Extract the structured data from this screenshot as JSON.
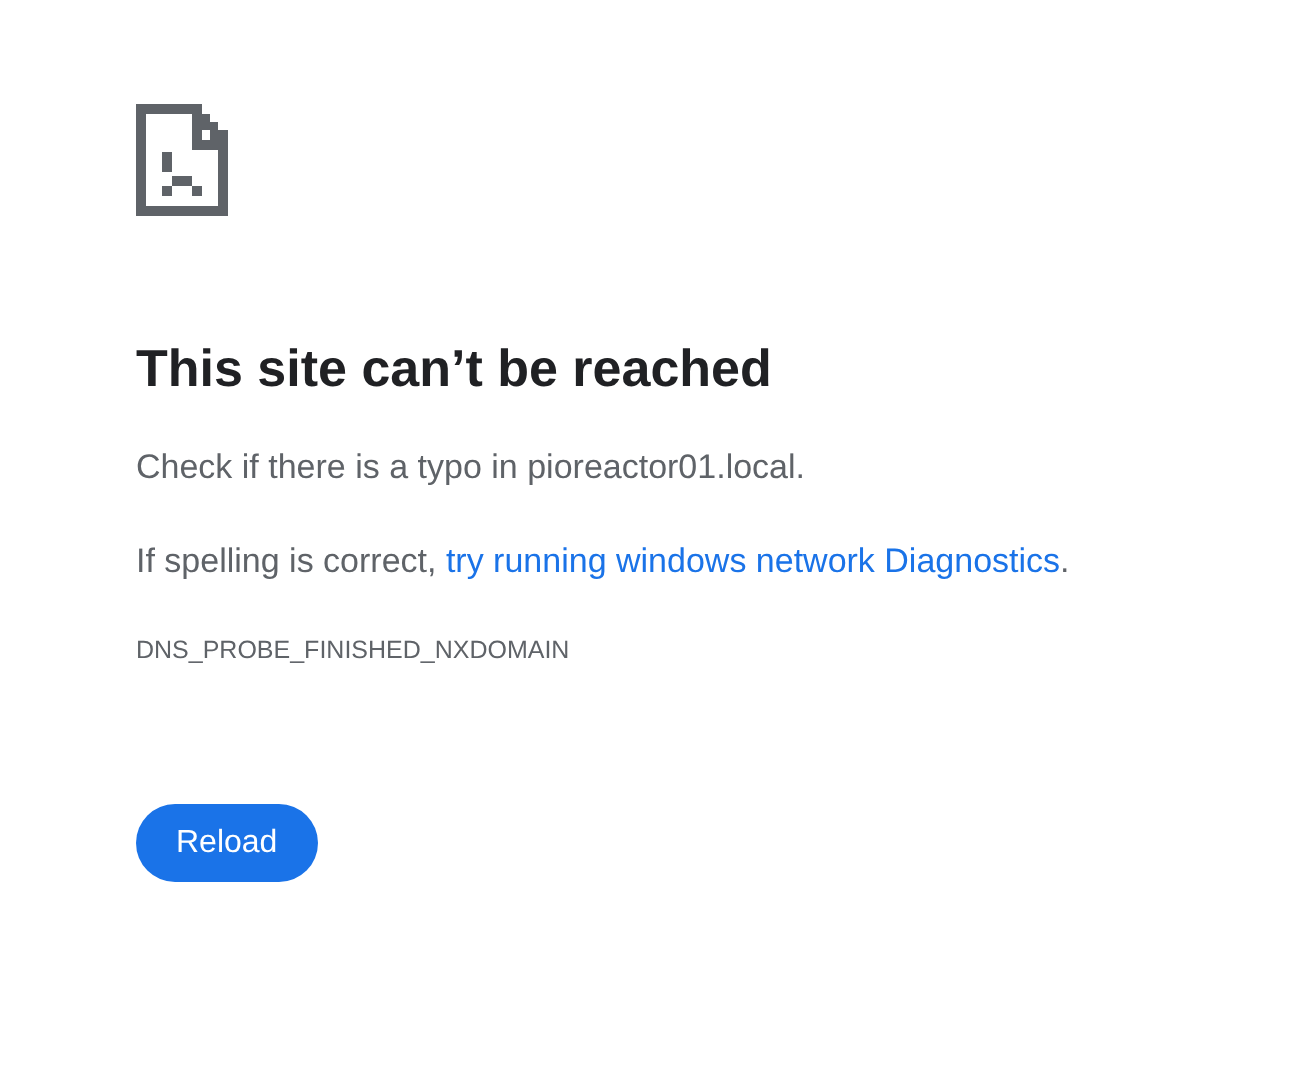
{
  "heading": "This site can’t be reached",
  "typo_message": "Check if there is a typo in pioreactor01.local.",
  "suggestion": {
    "before": "If spelling is correct, ",
    "link": "try running windows network Diagnostics",
    "after": "."
  },
  "error_code": "DNS_PROBE_FINISHED_NXDOMAIN",
  "buttons": [
    "Reload"
  ]
}
